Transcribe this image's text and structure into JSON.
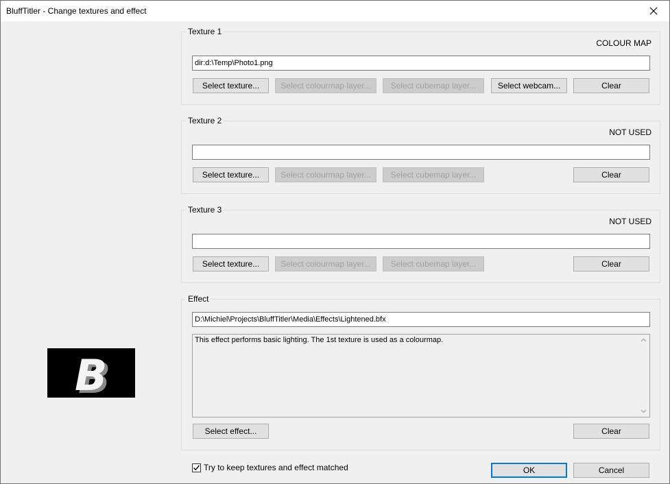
{
  "window": {
    "title": "BluffTitler - Change textures and effect"
  },
  "textures": [
    {
      "title": "Texture 1",
      "status": "COLOUR MAP",
      "path": "dir:d:\\Temp\\Photo1.png",
      "select_texture": "Select texture...",
      "select_colourmap": "Select colourmap layer...",
      "select_cubemap": "Select cubemap layer...",
      "select_webcam": "Select webcam...",
      "clear": "Clear"
    },
    {
      "title": "Texture 2",
      "status": "NOT USED",
      "path": "",
      "select_texture": "Select texture...",
      "select_colourmap": "Select colourmap layer...",
      "select_cubemap": "Select cubemap layer...",
      "clear": "Clear"
    },
    {
      "title": "Texture 3",
      "status": "NOT USED",
      "path": "",
      "select_texture": "Select texture...",
      "select_colourmap": "Select colourmap layer...",
      "select_cubemap": "Select cubemap layer...",
      "clear": "Clear"
    }
  ],
  "effect": {
    "title": "Effect",
    "path": "D:\\Michiel\\Projects\\BluffTitler\\Media\\Effects\\Lightened.bfx",
    "description": "This effect performs basic lighting. The 1st texture is used as a colourmap.",
    "select_effect": "Select effect...",
    "clear": "Clear"
  },
  "options": {
    "keep_matched_label": "Try to keep textures and effect matched",
    "keep_matched_checked": true
  },
  "preview": {
    "letter": "B"
  },
  "footer": {
    "ok": "OK",
    "cancel": "Cancel"
  },
  "colors": {
    "accent": "#0078d7",
    "background": "#f0f0f0"
  }
}
